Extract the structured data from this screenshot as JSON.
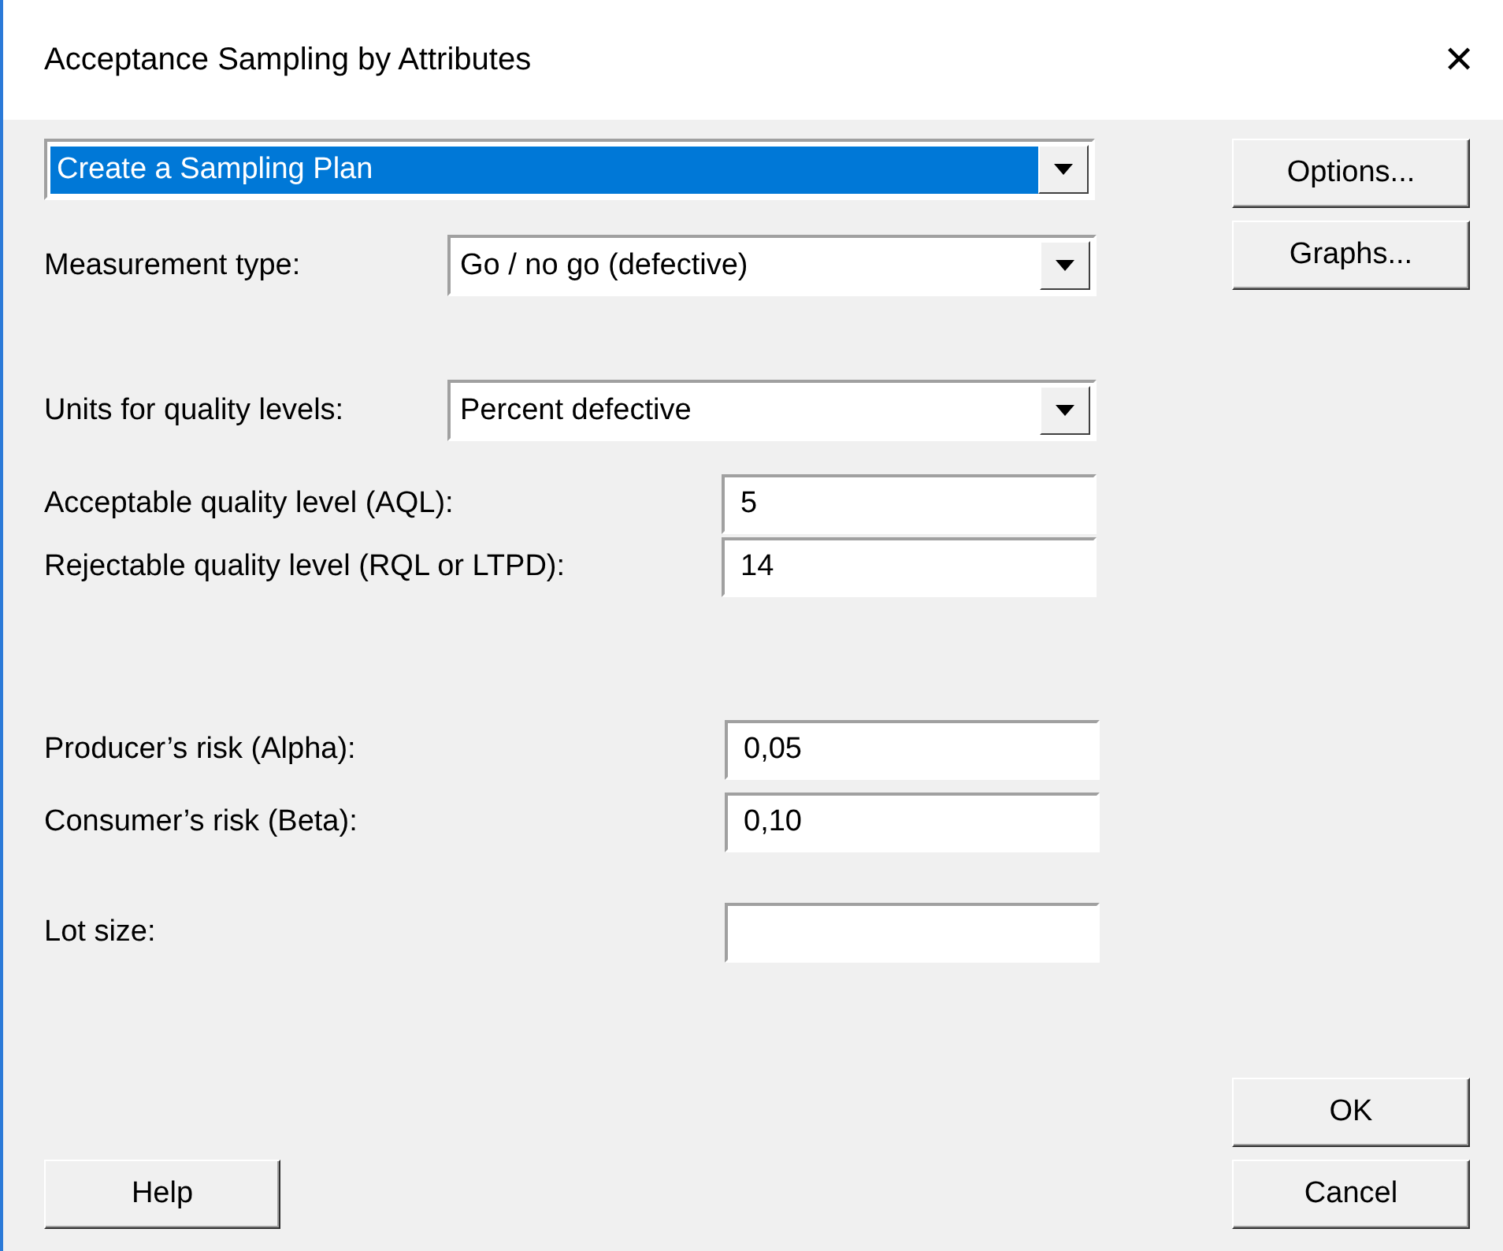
{
  "window": {
    "title": "Acceptance Sampling by Attributes",
    "close": "✕"
  },
  "mode": {
    "value": "Create a Sampling Plan",
    "selected": true
  },
  "combos": [
    {
      "label": "Measurement type:",
      "value": "Go / no go (defective)"
    },
    {
      "label": "Units for quality levels:",
      "value": "Percent defective"
    }
  ],
  "fields": [
    {
      "label": "Acceptable quality level (AQL):",
      "value": "5"
    },
    {
      "label": "Rejectable quality level (RQL or LTPD):",
      "value": "14"
    },
    {
      "label": "Producer’s risk (Alpha):",
      "value": "0,05"
    },
    {
      "label": "Consumer’s risk (Beta):",
      "value": "0,10"
    },
    {
      "label": "Lot size:"
    }
  ],
  "side_buttons": [
    "Options...",
    "Graphs..."
  ],
  "buttons": {
    "help": "Help",
    "ok": "OK",
    "cancel": "Cancel"
  }
}
